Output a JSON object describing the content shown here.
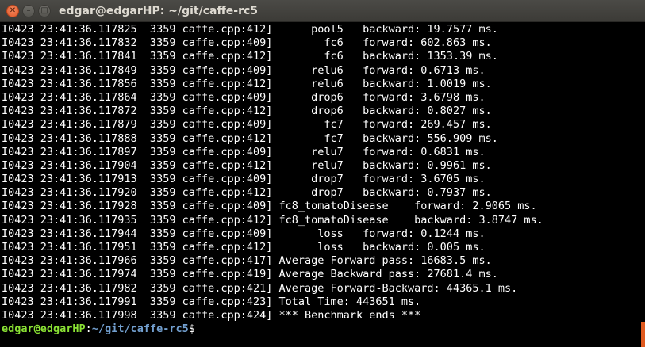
{
  "window": {
    "title": "edgar@edgarHP: ~/git/caffe-rc5",
    "close_glyph": "✕",
    "minimize_glyph": "–",
    "maximize_glyph": "□"
  },
  "colors": {
    "prompt_user": "#8ae234",
    "prompt_path": "#729fcf",
    "scroll_marker": "#e05a1f",
    "close_button": "#e0582a"
  },
  "terminal": {
    "lines": [
      "I0423 23:41:36.117825  3359 caffe.cpp:412]      pool5   backward: 19.7577 ms.",
      "I0423 23:41:36.117832  3359 caffe.cpp:409]        fc6   forward: 602.863 ms.",
      "I0423 23:41:36.117841  3359 caffe.cpp:412]        fc6   backward: 1353.39 ms.",
      "I0423 23:41:36.117849  3359 caffe.cpp:409]      relu6   forward: 0.6713 ms.",
      "I0423 23:41:36.117856  3359 caffe.cpp:412]      relu6   backward: 1.0019 ms.",
      "I0423 23:41:36.117864  3359 caffe.cpp:409]      drop6   forward: 3.6798 ms.",
      "I0423 23:41:36.117872  3359 caffe.cpp:412]      drop6   backward: 0.8027 ms.",
      "I0423 23:41:36.117879  3359 caffe.cpp:409]        fc7   forward: 269.457 ms.",
      "I0423 23:41:36.117888  3359 caffe.cpp:412]        fc7   backward: 556.909 ms.",
      "I0423 23:41:36.117897  3359 caffe.cpp:409]      relu7   forward: 0.6831 ms.",
      "I0423 23:41:36.117904  3359 caffe.cpp:412]      relu7   backward: 0.9961 ms.",
      "I0423 23:41:36.117913  3359 caffe.cpp:409]      drop7   forward: 3.6705 ms.",
      "I0423 23:41:36.117920  3359 caffe.cpp:412]      drop7   backward: 0.7937 ms.",
      "I0423 23:41:36.117928  3359 caffe.cpp:409] fc8_tomatoDisease    forward: 2.9065 ms.",
      "I0423 23:41:36.117935  3359 caffe.cpp:412] fc8_tomatoDisease    backward: 3.8747 ms.",
      "I0423 23:41:36.117944  3359 caffe.cpp:409]       loss   forward: 0.1244 ms.",
      "I0423 23:41:36.117951  3359 caffe.cpp:412]       loss   backward: 0.005 ms.",
      "I0423 23:41:36.117966  3359 caffe.cpp:417] Average Forward pass: 16683.5 ms.",
      "I0423 23:41:36.117974  3359 caffe.cpp:419] Average Backward pass: 27681.4 ms.",
      "I0423 23:41:36.117982  3359 caffe.cpp:421] Average Forward-Backward: 44365.1 ms.",
      "I0423 23:41:36.117991  3359 caffe.cpp:423] Total Time: 443651 ms.",
      "I0423 23:41:36.117998  3359 caffe.cpp:424] *** Benchmark ends ***"
    ],
    "prompt": {
      "user_host": "edgar@edgarHP",
      "colon": ":",
      "path": "~/git/caffe-rc5",
      "symbol": "$"
    }
  }
}
